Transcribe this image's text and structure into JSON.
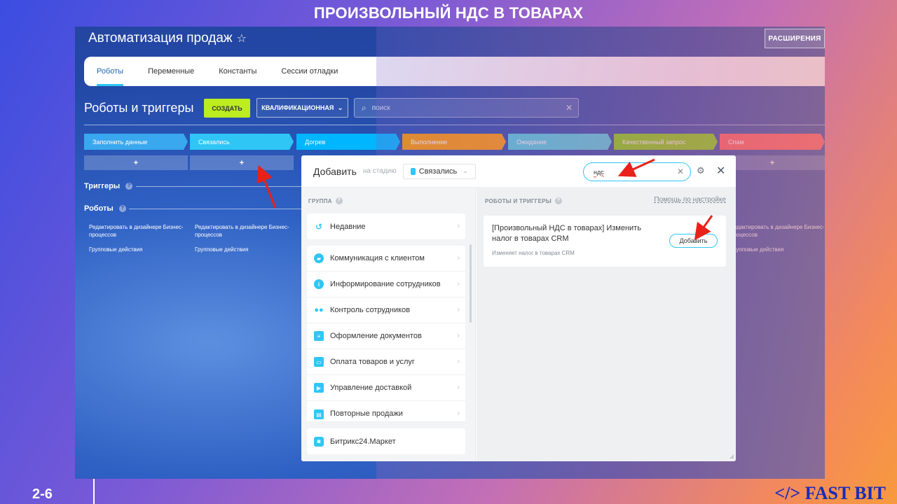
{
  "slide": {
    "title": "ПРОИЗВОЛЬНЫЙ НДС В ТОВАРАХ",
    "page_number": "2-6",
    "logo": "</> FAST BIT"
  },
  "app": {
    "title": "Автоматизация продаж",
    "star_icon": "star-icon",
    "extensions_label": "РАСШИРЕНИЯ"
  },
  "tabs": [
    {
      "label": "Роботы",
      "active": true
    },
    {
      "label": "Переменные",
      "active": false
    },
    {
      "label": "Константы",
      "active": false
    },
    {
      "label": "Сессии отладки",
      "active": false
    }
  ],
  "toolbar": {
    "section_title": "Роботы и триггеры",
    "create_label": "СОЗДАТЬ",
    "pipeline_label": "КВАЛИФИКАЦИОННАЯ",
    "search_placeholder": "поиск"
  },
  "stages": [
    {
      "label": "Заполнить данные",
      "color": "#39a8ef"
    },
    {
      "label": "Связались",
      "color": "#2fc6f6"
    },
    {
      "label": "Догрев",
      "color": "#00b6ff"
    },
    {
      "label": "Выполнение",
      "color": "#ff9900"
    },
    {
      "label": "Ожидание",
      "color": "#47d1e2"
    },
    {
      "label": "Качественный запрос",
      "color": "#7bd500"
    },
    {
      "label": "Спам",
      "color": "#ff5752"
    }
  ],
  "add_label": "+",
  "triggers_label": "Триггеры",
  "robots_label": "Роботы",
  "robot_links": {
    "edit": "Редактировать в дизайнере Бизнес-процессов",
    "group": "Групповые действия"
  },
  "popup": {
    "title": "Добавить",
    "on_stage_label": "на стадию",
    "stage_value": "Связались",
    "search_value": "ндс",
    "left_header": "ГРУППА",
    "right_header": "РОБОТЫ И ТРИГГЕРЫ",
    "help_link": "Помощь по настройке",
    "groups": [
      {
        "label": "Недавние",
        "icon": "clock-icon"
      },
      {
        "label": "Коммуникация с клиентом",
        "icon": "chat-icon"
      },
      {
        "label": "Информирование сотрудников",
        "icon": "info-icon"
      },
      {
        "label": "Контроль сотрудников",
        "icon": "users-icon"
      },
      {
        "label": "Оформление документов",
        "icon": "document-icon"
      },
      {
        "label": "Оплата товаров и услуг",
        "icon": "wallet-icon"
      },
      {
        "label": "Управление доставкой",
        "icon": "truck-icon"
      },
      {
        "label": "Повторные продажи",
        "icon": "store-icon"
      },
      {
        "label": "Битрикс24.Маркет",
        "icon": "market-bag-icon"
      }
    ],
    "result": {
      "title": "[Произвольный НДС в товарах] Изменить налог в товарах CRM",
      "description": "Изменяет налог в товарах CRM",
      "add_label": "Добавить"
    }
  }
}
